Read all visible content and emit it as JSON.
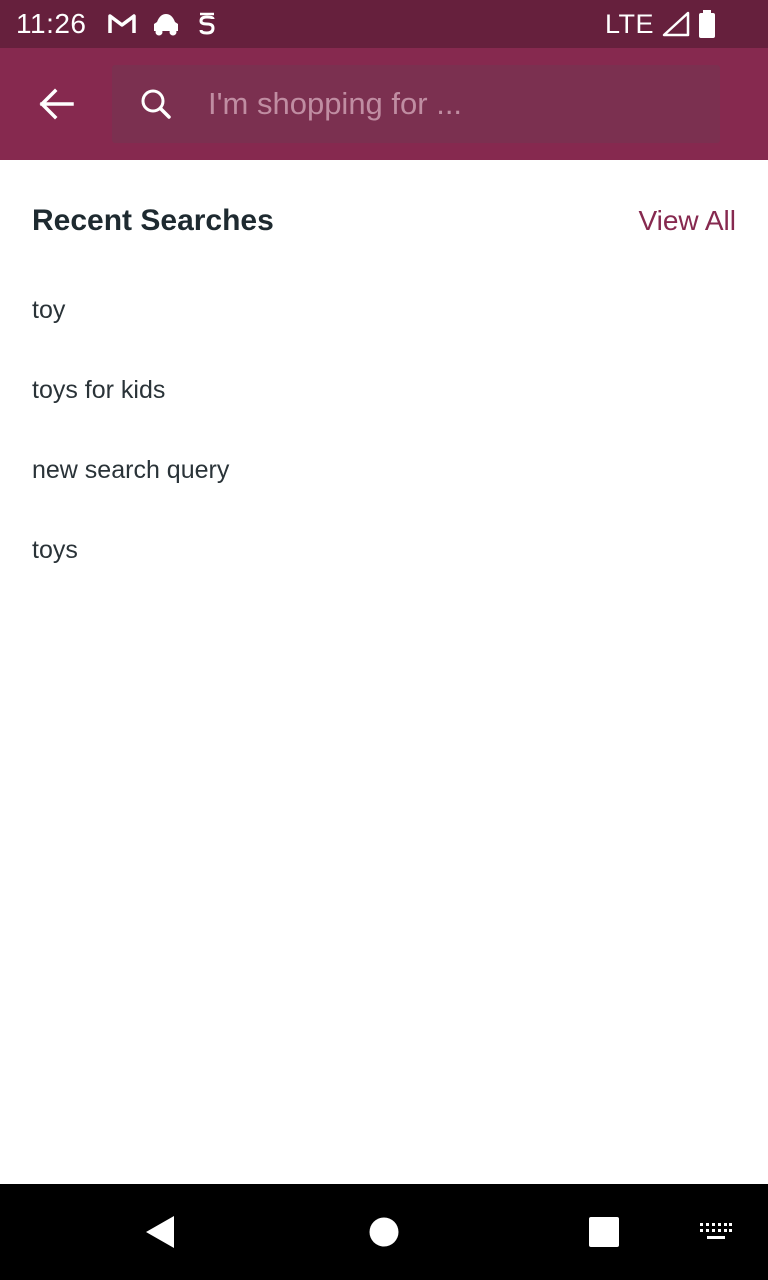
{
  "status_bar": {
    "time": "11:26",
    "network": "LTE",
    "icons_left": [
      "gmail-icon",
      "car-icon",
      "app-s-icon"
    ],
    "icons_right": [
      "signal-icon",
      "battery-icon"
    ]
  },
  "app_bar": {
    "back_icon": "arrow-left-icon",
    "search": {
      "icon": "search-icon",
      "placeholder": "I'm shopping for ...",
      "value": ""
    }
  },
  "recent_searches": {
    "title": "Recent Searches",
    "view_all_label": "View All",
    "items": [
      "toy",
      "toys for kids",
      "new search query",
      "toys"
    ]
  },
  "nav_bar": {
    "buttons": [
      "back-triangle-icon",
      "home-circle-icon",
      "recents-square-icon",
      "keyboard-icon"
    ]
  },
  "colors": {
    "status_bar": "#66203d",
    "app_bar": "#86294f",
    "search_box": "#7b3050",
    "accent": "#86294f",
    "title_text": "#1e2a30",
    "item_text": "#2a3338"
  }
}
